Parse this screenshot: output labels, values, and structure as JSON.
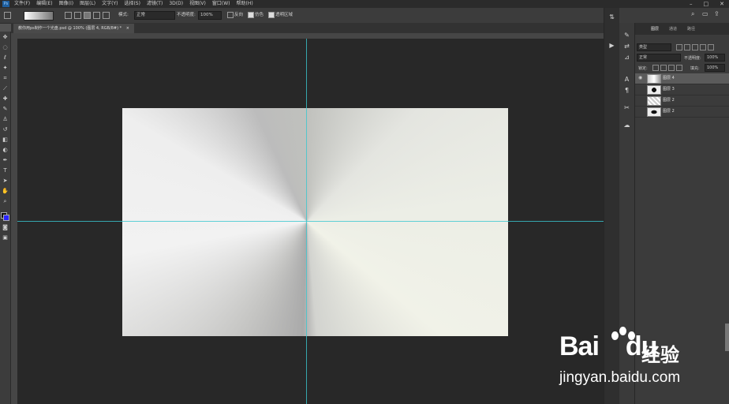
{
  "menubar": {
    "logo": "Ps",
    "items": [
      "文件(F)",
      "编辑(E)",
      "图像(I)",
      "图层(L)",
      "文字(Y)",
      "选择(S)",
      "滤镜(T)",
      "3D(D)",
      "视图(V)",
      "窗口(W)",
      "帮助(H)"
    ]
  },
  "options": {
    "mode_label": "模式:",
    "mode_value": "正常",
    "opacity_label": "不透明度:",
    "opacity_value": "100%",
    "reverse_label": "反向",
    "dither_label": "仿色",
    "transparency_label": "透明区域"
  },
  "document": {
    "tab_title": "教你用ps制作一个光盘.psd @ 100% (图层 4, RGB/8#) *",
    "close": "×"
  },
  "layers_panel": {
    "tabs": [
      "图层",
      "通道",
      "路径"
    ],
    "filter_label": "类型",
    "blend_mode": "正常",
    "opacity_label": "不透明度:",
    "opacity_value": "100%",
    "lock_label": "锁定:",
    "fill_label": "填充:",
    "fill_value": "100%",
    "layers": [
      {
        "name": "图层 4",
        "selected": true,
        "visible": true
      },
      {
        "name": "图层 3",
        "selected": false,
        "visible": false
      },
      {
        "name": "图层 2",
        "selected": false,
        "visible": false
      },
      {
        "name": "图层 2",
        "selected": false,
        "visible": false
      }
    ]
  },
  "watermark": {
    "brand": "Bai",
    "brand_du": "du",
    "cn": "经验",
    "url": "jingyan.baidu.com"
  },
  "colors": {
    "foreground": "#111111",
    "background": "#2a24ff",
    "guide": "#39c7cf"
  }
}
